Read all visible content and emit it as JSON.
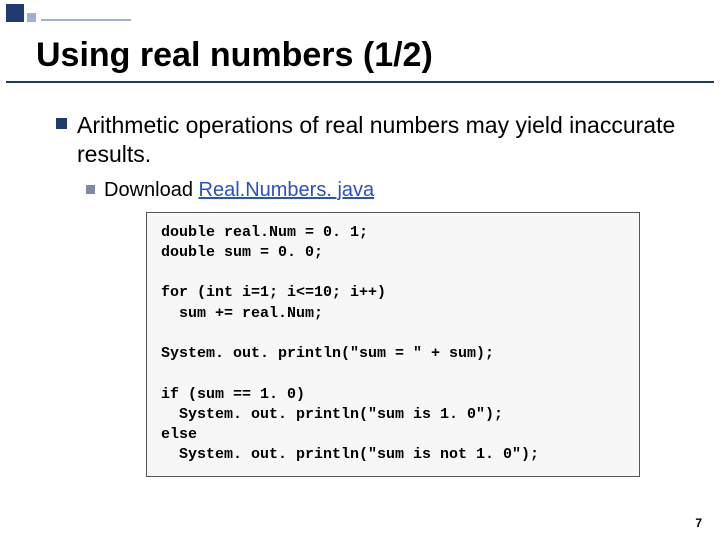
{
  "title": "Using real numbers (1/2)",
  "bullets": {
    "main": "Arithmetic operations of real numbers may yield inaccurate results.",
    "sub_prefix": "Download ",
    "sub_link": "Real.Numbers. java"
  },
  "code": "double real.Num = 0. 1;\ndouble sum = 0. 0;\n\nfor (int i=1; i<=10; i++)\n  sum += real.Num;\n\nSystem. out. println(\"sum = \" + sum);\n\nif (sum == 1. 0)\n  System. out. println(\"sum is 1. 0\");\nelse\n  System. out. println(\"sum is not 1. 0\");",
  "page_number": "7"
}
